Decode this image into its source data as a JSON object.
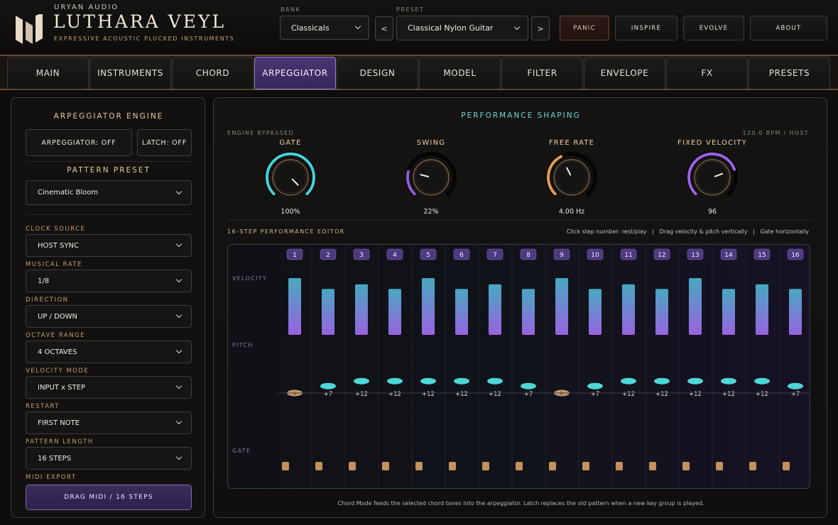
{
  "brand": {
    "company": "URYAN AUDIO",
    "title": "LUTHARA VEYL",
    "tagline": "EXPRESSIVE ACOUSTIC PLUCKED INSTRUMENTS"
  },
  "header": {
    "bank_label": "BANK",
    "bank_value": "Classicals",
    "preset_label": "PRESET",
    "preset_value": "Classical Nylon Guitar",
    "prev_label": "<",
    "next_label": ">",
    "buttons": [
      "PANIC",
      "INSPIRE",
      "EVOLVE",
      "ABOUT"
    ]
  },
  "tabs": [
    "MAIN",
    "INSTRUMENTS",
    "CHORD",
    "ARPEGGIATOR",
    "DESIGN",
    "MODEL",
    "FILTER",
    "ENVELOPE",
    "FX",
    "PRESETS"
  ],
  "active_tab": "ARPEGGIATOR",
  "left_panel": {
    "title": "ARPEGGIATOR ENGINE",
    "arp_toggle": "ARPEGGIATOR: OFF",
    "latch_toggle": "LATCH: OFF",
    "pattern_preset_title": "PATTERN PRESET",
    "pattern_preset_value": "Cinematic Bloom",
    "settings": [
      {
        "label": "CLOCK SOURCE",
        "value": "HOST SYNC"
      },
      {
        "label": "MUSICAL RATE",
        "value": "1/8"
      },
      {
        "label": "DIRECTION",
        "value": "UP / DOWN"
      },
      {
        "label": "OCTAVE RANGE",
        "value": "4 OCTAVES"
      },
      {
        "label": "VELOCITY MODE",
        "value": "INPUT x STEP"
      },
      {
        "label": "RESTART",
        "value": "FIRST NOTE"
      },
      {
        "label": "PATTERN LENGTH",
        "value": "16 STEPS"
      }
    ],
    "midi_export_label": "MIDI EXPORT",
    "drag_midi": "DRAG MIDI  /  16 STEPS"
  },
  "main_panel": {
    "title": "PERFORMANCE SHAPING",
    "status_left": "ENGINE BYPASSED",
    "status_right": "120.0 BPM / HOST",
    "knobs": [
      {
        "label": "GATE",
        "value": "100%",
        "level": 1.0,
        "color": "#47d0d8"
      },
      {
        "label": "SWING",
        "value": "22%",
        "level": 0.22,
        "color": "#8d5ed8"
      },
      {
        "label": "FREE RATE",
        "value": "4.00 Hz",
        "level": 0.4,
        "color": "#e39a56"
      },
      {
        "label": "FIXED VELOCITY",
        "value": "96",
        "level": 0.76,
        "color": "#a062e8"
      }
    ],
    "editor_title": "16-STEP PERFORMANCE EDITOR",
    "editor_hints": [
      "Click step number: rest/play",
      "|",
      "Drag velocity & pitch vertically",
      "|",
      "Gate horizontally"
    ],
    "row_labels": {
      "velocity": "VELOCITY",
      "pitch": "PITCH",
      "gate": "GATE"
    },
    "steps": [
      {
        "num": "1",
        "velocity": 1.0,
        "pitch": "0"
      },
      {
        "num": "2",
        "velocity": 0.81,
        "pitch": "+7"
      },
      {
        "num": "3",
        "velocity": 0.89,
        "pitch": "+12"
      },
      {
        "num": "4",
        "velocity": 0.81,
        "pitch": "+12"
      },
      {
        "num": "5",
        "velocity": 1.0,
        "pitch": "+12"
      },
      {
        "num": "6",
        "velocity": 0.81,
        "pitch": "+12"
      },
      {
        "num": "7",
        "velocity": 0.89,
        "pitch": "+12"
      },
      {
        "num": "8",
        "velocity": 0.81,
        "pitch": "+7"
      },
      {
        "num": "9",
        "velocity": 1.0,
        "pitch": "0"
      },
      {
        "num": "10",
        "velocity": 0.81,
        "pitch": "+7"
      },
      {
        "num": "11",
        "velocity": 0.89,
        "pitch": "+12"
      },
      {
        "num": "12",
        "velocity": 0.81,
        "pitch": "+12"
      },
      {
        "num": "13",
        "velocity": 1.0,
        "pitch": "+12"
      },
      {
        "num": "14",
        "velocity": 0.81,
        "pitch": "+12"
      },
      {
        "num": "15",
        "velocity": 0.89,
        "pitch": "+12"
      },
      {
        "num": "16",
        "velocity": 0.81,
        "pitch": "+7"
      }
    ],
    "footer": "Chord Mode feeds the selected chord tones into the arpeggiator. Latch replaces the old pattern when a new key group is played."
  },
  "colors": {
    "accent_purple": "#8b6fd0",
    "accent_cyan": "#47d0d8",
    "accent_gold": "#c9a56c",
    "velocity_top": "#47a9c0",
    "velocity_bottom": "#9a62e0",
    "pitch_dot": "#4fd6d6",
    "pitch_zero": "#c69a6e",
    "gate_block": "#c4915d"
  }
}
